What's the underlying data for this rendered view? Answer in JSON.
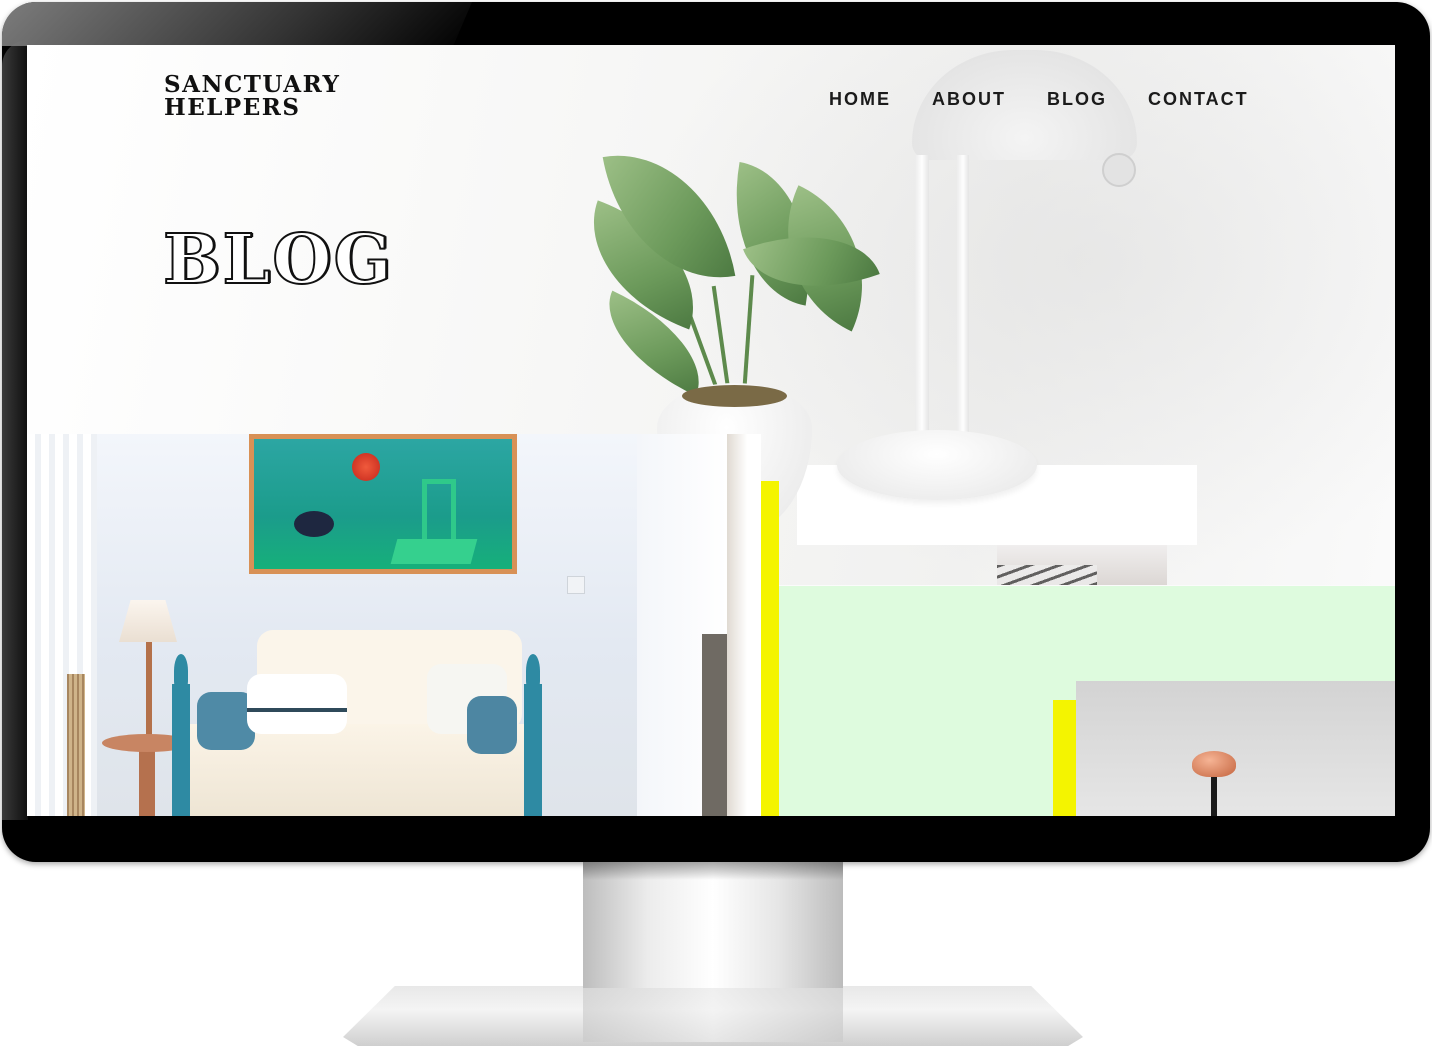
{
  "site": {
    "logo_line1": "SANCTUARY",
    "logo_line2": "HELPERS"
  },
  "nav": {
    "items": [
      {
        "label": "HOME"
      },
      {
        "label": "ABOUT"
      },
      {
        "label": "BLOG"
      },
      {
        "label": "CONTACT"
      }
    ]
  },
  "hero": {
    "title": "BLOG"
  },
  "colors": {
    "accent_yellow": "#f4f400",
    "accent_mint": "#defbde",
    "monitor_bezel": "#000000"
  },
  "icons": {
    "device": "desktop-monitor"
  }
}
